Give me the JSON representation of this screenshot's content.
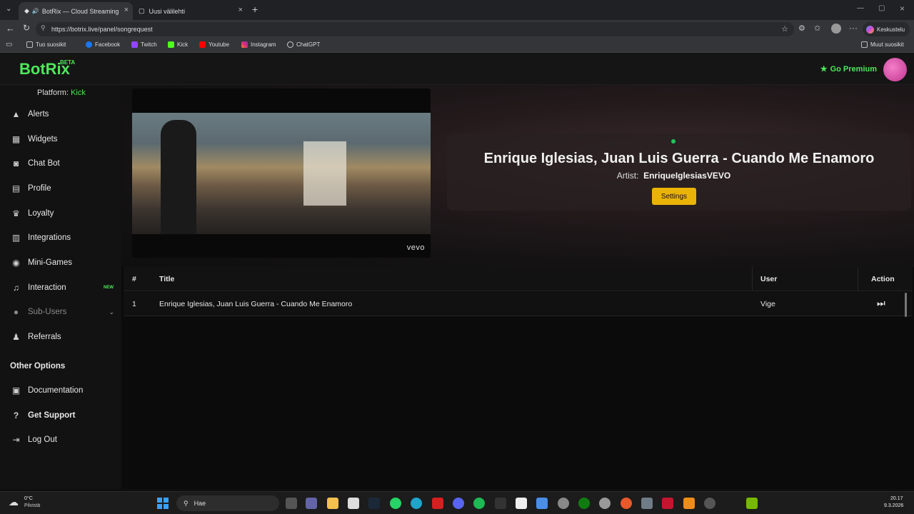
{
  "browser": {
    "tabs": [
      {
        "label": "BotRix — Cloud Streaming Bo",
        "active": true
      },
      {
        "label": "Uusi välilehti",
        "active": false
      }
    ],
    "url": "https://botrix.live/panel/songrequest",
    "profile_label": "Keskustelu",
    "bookmarks": [
      "Tuo suosikit",
      "Facebook",
      "Twitch",
      "Kick",
      "Youtube",
      "Instagram",
      "ChatGPT"
    ],
    "other_bookmarks": "Muut suosikit"
  },
  "app": {
    "logo": "BotRix",
    "beta": "BETA",
    "premium_label": "Go Premium",
    "platform_label": "Platform:",
    "platform_value": "Kick",
    "nav": [
      {
        "label": "Alerts",
        "icon": "alert-icon"
      },
      {
        "label": "Widgets",
        "icon": "widgets-icon"
      },
      {
        "label": "Chat Bot",
        "icon": "robot-icon"
      },
      {
        "label": "Profile",
        "icon": "profile-icon"
      },
      {
        "label": "Loyalty",
        "icon": "trophy-icon"
      },
      {
        "label": "Integrations",
        "icon": "integrations-icon"
      },
      {
        "label": "Mini-Games",
        "icon": "gamepad-icon"
      },
      {
        "label": "Interaction",
        "icon": "music-icon",
        "badge": "NEW"
      },
      {
        "label": "Sub-Users",
        "icon": "users-icon"
      },
      {
        "label": "Referrals",
        "icon": "referrals-icon"
      }
    ],
    "other_title": "Other Options",
    "other": [
      {
        "label": "Documentation",
        "icon": "documentation-icon"
      },
      {
        "label": "Get Support",
        "icon": "help-icon"
      },
      {
        "label": "Log Out",
        "icon": "logout-icon"
      }
    ]
  },
  "player": {
    "watermark": "vevo",
    "song_title": "Enrique Iglesias, Juan Luis Guerra - Cuando Me Enamoro",
    "artist_label": "Artist:",
    "artist_value": "EnriqueIglesiasVEVO",
    "settings_label": "Settings"
  },
  "queue": {
    "columns": [
      "#",
      "Title",
      "User",
      "Action"
    ],
    "rows": [
      {
        "num": "1",
        "title": "Enrique Iglesias, Juan Luis Guerra - Cuando Me Enamoro",
        "user": "Vige"
      }
    ]
  },
  "taskbar": {
    "weather_temp": "0°C",
    "weather_desc": "Pilvistä",
    "search_placeholder": "Hae",
    "time": "20.17",
    "date": "9.3.2026"
  }
}
